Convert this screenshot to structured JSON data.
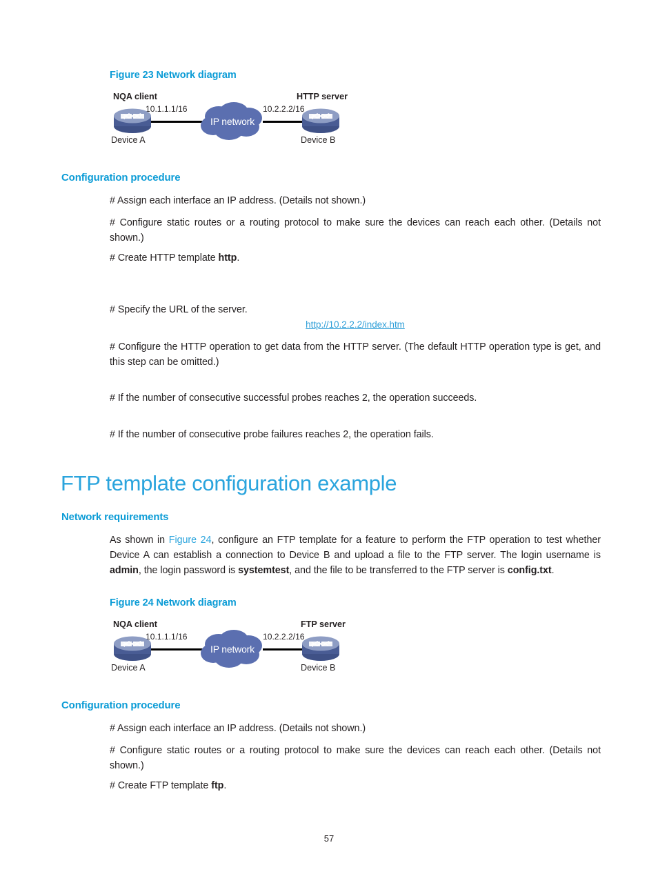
{
  "page": {
    "number": "57"
  },
  "figure23": {
    "caption": "Figure 23 Network diagram",
    "left_label": "NQA client",
    "right_label": "HTTP server",
    "left_ip": "10.1.1.1/16",
    "right_ip": "10.2.2.2/16",
    "cloud_label": "IP network",
    "left_device": "Device A",
    "right_device": "Device B"
  },
  "section1": {
    "heading": "Configuration procedure",
    "line1": "# Assign each interface an IP address. (Details not shown.)",
    "line2": "# Configure static routes or a routing protocol to make sure the devices can reach each other. (Details not shown.)",
    "line3_pre": "# Create HTTP template ",
    "line3_bold": "http",
    "line3_post": ".",
    "line4": "# Specify the URL of the server.",
    "url": "http://10.2.2.2/index.htm",
    "line5": "# Configure the HTTP operation to get data from the HTTP server. (The default HTTP operation type is get, and this step can be omitted.)",
    "line6": "# If the number of consecutive successful probes reaches 2, the operation succeeds.",
    "line7": "# If the number of consecutive probe failures reaches 2, the operation fails."
  },
  "section2": {
    "title": "FTP template configuration example",
    "requirements_heading": "Network requirements",
    "req_part1": "As shown in ",
    "req_figref": "Figure 24",
    "req_part2": ", configure an FTP template for a feature to perform the FTP operation to test whether Device A can establish a connection to Device B and upload a file to the FTP server. The login username is ",
    "req_bold1": "admin",
    "req_part3": ", the login password is ",
    "req_bold2": "systemtest",
    "req_part4": ", and the file to be transferred to the FTP server is ",
    "req_bold3": "config.txt",
    "req_part5": "."
  },
  "figure24": {
    "caption": "Figure 24 Network diagram",
    "left_label": "NQA client",
    "right_label": "FTP server",
    "left_ip": "10.1.1.1/16",
    "right_ip": "10.2.2.2/16",
    "cloud_label": "IP network",
    "left_device": "Device A",
    "right_device": "Device B"
  },
  "section3": {
    "heading": "Configuration procedure",
    "line1": "# Assign each interface an IP address. (Details not shown.)",
    "line2": "# Configure static routes or a routing protocol to make sure the devices can reach each other. (Details not shown.)",
    "line3_pre": "# Create FTP template ",
    "line3_bold": "ftp",
    "line3_post": "."
  },
  "colors": {
    "heading_blue": "#0c9cd6",
    "title_blue": "#2aa4dd",
    "link_blue": "#2f9fd8",
    "cloud_blue": "#5b6fb0",
    "router_top": "#8e9dc4",
    "router_body": "#4a5e96",
    "text_black": "#231f20"
  }
}
